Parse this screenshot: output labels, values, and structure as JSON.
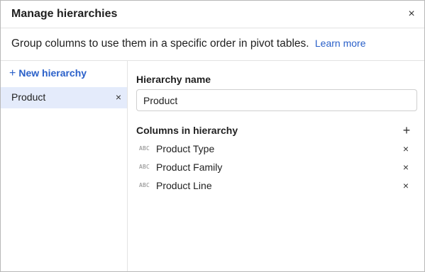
{
  "dialog": {
    "title": "Manage hierarchies",
    "close_icon": "×",
    "description": "Group columns to use them in a specific order in pivot tables.",
    "learn_more": "Learn more"
  },
  "sidebar": {
    "new_hierarchy_icon": "+",
    "new_hierarchy_label": "New hierarchy",
    "items": [
      {
        "label": "Product",
        "remove_icon": "×",
        "selected": true
      }
    ]
  },
  "editor": {
    "name_label": "Hierarchy name",
    "name_value": "Product",
    "columns_label": "Columns in hierarchy",
    "add_column_icon": "+",
    "columns": [
      {
        "type": "ABC",
        "name": "Product Type",
        "remove_icon": "×"
      },
      {
        "type": "ABC",
        "name": "Product Family",
        "remove_icon": "×"
      },
      {
        "type": "ABC",
        "name": "Product Line",
        "remove_icon": "×"
      }
    ]
  },
  "colors": {
    "accent": "#2a60c9",
    "selected_bg": "#e4ebfb",
    "border": "#e3e3e3"
  }
}
